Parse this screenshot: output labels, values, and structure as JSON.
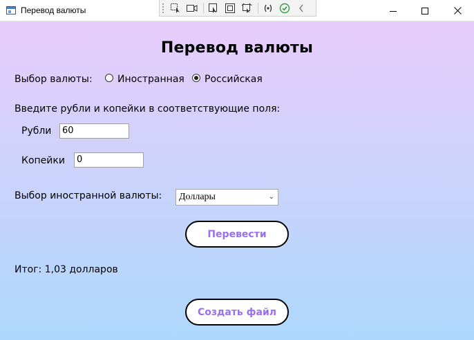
{
  "window": {
    "title": "Перевод валюты",
    "minimize_glyph": "─",
    "maximize_glyph": "☐",
    "close_glyph": "✕"
  },
  "dev_toolbar": {
    "icons": [
      "select-element-icon",
      "record-icon",
      "pointer-icon",
      "frame-icon",
      "track-focus-icon",
      "binding-icon",
      "check-icon",
      "collapse-icon"
    ]
  },
  "form": {
    "heading": "Перевод валюты",
    "currency_choice_label": "Выбор валюты:",
    "radio_foreign": "Иностранная",
    "radio_russian": "Российская",
    "selected_radio": "Российская",
    "instructions": "Введите рубли и копейки в соответствующие поля:",
    "rubles_label": "Рубли",
    "rubles_value": "60",
    "kopecks_label": "Копейки",
    "kopecks_value": "0",
    "foreign_currency_label": "Выбор иностранной валюты:",
    "foreign_currency_selected": "Доллары",
    "convert_button": "Перевести",
    "result_text": "Итог: 1,03 долларов",
    "create_file_button": "Создать файл"
  },
  "colors": {
    "gradient_top": "#e8ccfb",
    "gradient_bottom": "#aed7fd",
    "button_text": "#9a6ff0"
  }
}
